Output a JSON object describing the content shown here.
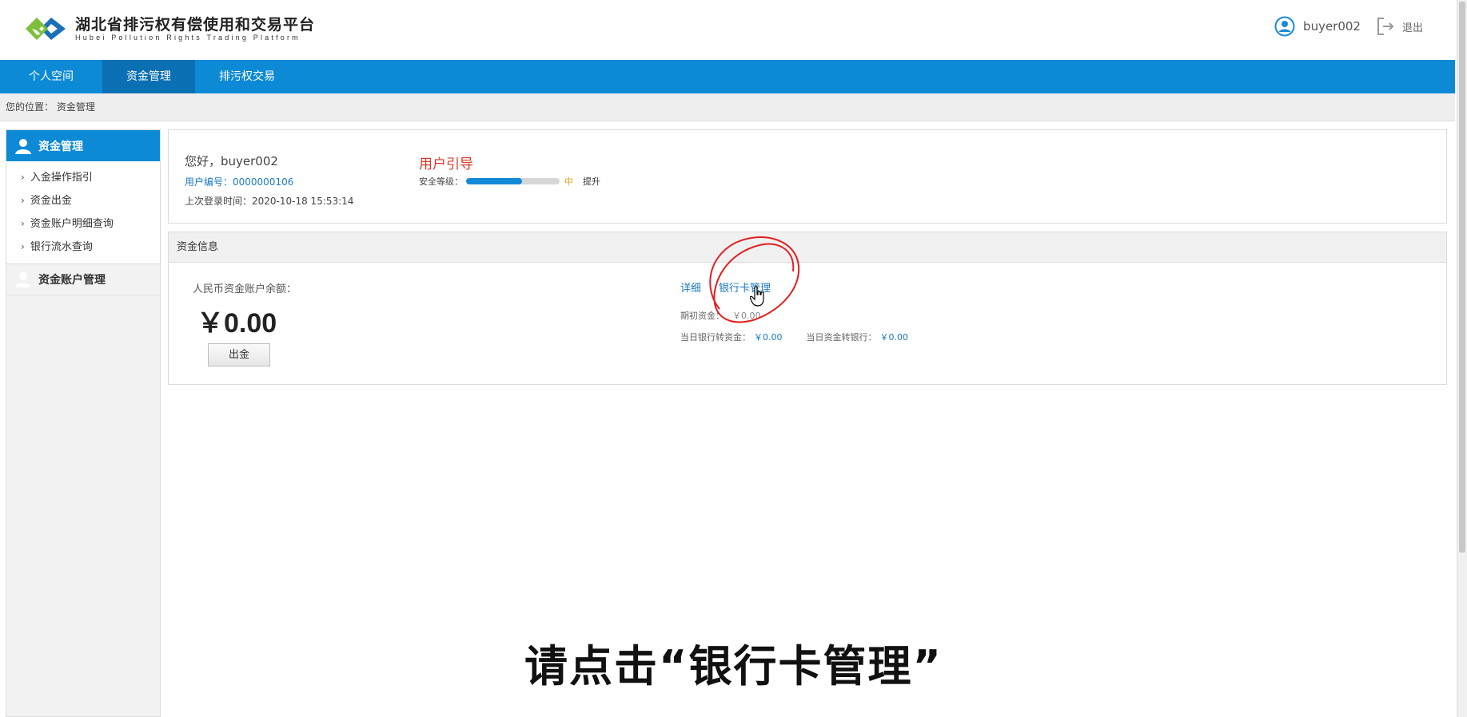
{
  "brand": {
    "title": "湖北省排污权有偿使用和交易平台",
    "subtitle": "Hubei Pollution Rights Trading Platform",
    "colors": {
      "primary": "#0c8ad6",
      "primary_dark": "#0a6fb3",
      "logo_green": "#7cbf3a",
      "logo_blue": "#1a6fb8"
    }
  },
  "user": {
    "name": "buyer002",
    "logout_label": "退出",
    "icon": "user-circle-icon"
  },
  "nav": {
    "items": [
      {
        "label": "个人空间"
      },
      {
        "label": "资金管理"
      },
      {
        "label": "排污权交易"
      }
    ],
    "active_index": 1
  },
  "breadcrumb": {
    "text": "您的位置：  资金管理"
  },
  "sidebar": {
    "section1": {
      "label": "资金管理",
      "icon": "user-icon"
    },
    "items": [
      {
        "label": "入金操作指引"
      },
      {
        "label": "资金出金"
      },
      {
        "label": "资金账户明细查询"
      },
      {
        "label": "银行流水查询"
      }
    ],
    "section2": {
      "label": "资金账户管理",
      "icon": "user-icon"
    }
  },
  "profile": {
    "greeting": "您好，buyer002",
    "user_no": "用户编号：0000000106",
    "last_login": "上次登录时间：2020-10-18 15:53:14",
    "guide": "用户引导",
    "security_label": "安全等级：",
    "security_fraction": 0.6,
    "security_level": "中",
    "upgrade": "提升"
  },
  "funds": {
    "header": "资金信息",
    "balance_label": "人民币资金账户余额：",
    "balance_value": "￥0.00",
    "withdraw_button": "出金",
    "detail_link": "详细",
    "bank_card_link": "银行卡管理",
    "opening_label": "期初资金：",
    "opening_value": "￥0.00",
    "bank_to_fund_label": "当日银行转资金：",
    "bank_to_fund_value": "￥0.00",
    "fund_to_bank_label": "当日资金转银行：",
    "fund_to_bank_value": "￥0.00"
  },
  "caption": "请点击“银行卡管理”"
}
